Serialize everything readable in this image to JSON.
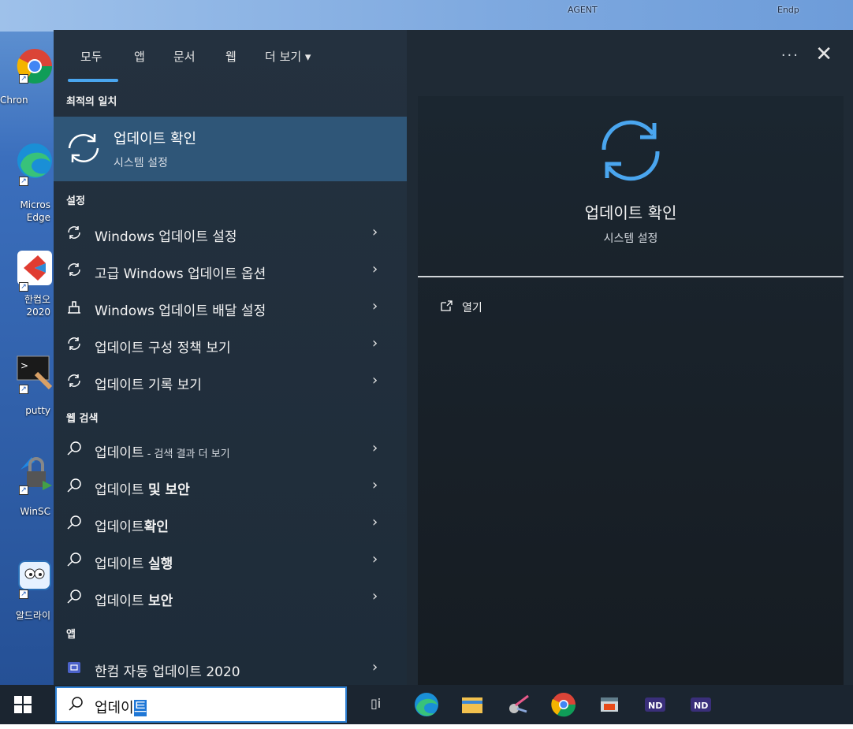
{
  "desktop": {
    "top_labels": [
      "AGENT",
      "Endp"
    ],
    "icons": [
      {
        "label": "Chron"
      },
      {
        "label": "Micros Edge"
      },
      {
        "label": "한컴오 2020"
      },
      {
        "label": "putty"
      },
      {
        "label": "WinSC"
      },
      {
        "label": "알드라이"
      }
    ]
  },
  "search_panel": {
    "tabs": [
      "모두",
      "앱",
      "문서",
      "웹",
      "더 보기 ▾"
    ],
    "more_label": "···",
    "close_label": "✕",
    "best_match": {
      "section": "최적의 일치",
      "title": "업데이트 확인",
      "subtitle": "시스템 설정"
    },
    "settings_section": "설정",
    "settings_items": [
      "Windows 업데이트 설정",
      "고급 Windows 업데이트 옵션",
      "Windows 업데이트 배달 설정",
      "업데이트 구성 정책 보기",
      "업데이트 기록 보기"
    ],
    "web_section": "웹 검색",
    "web_items": [
      {
        "main": "업데이트",
        "suffix": " - 검색 결과 더 보기",
        "bold": ""
      },
      {
        "main": "업데이트 ",
        "suffix": "",
        "bold": "및 보안"
      },
      {
        "main": "업데이트",
        "suffix": "",
        "bold": "확인"
      },
      {
        "main": "업데이트 ",
        "suffix": "",
        "bold": "실행"
      },
      {
        "main": "업데이트 ",
        "suffix": "",
        "bold": "보안"
      }
    ],
    "apps_section": "앱",
    "apps_items": [
      "한컴 자동 업데이트 2020"
    ],
    "preview": {
      "title": "업데이트 확인",
      "subtitle": "시스템 설정",
      "action_open": "열기"
    }
  },
  "taskbar": {
    "search_text_plain": "업데이",
    "search_text_selected": "트",
    "task_view_label": "▯i",
    "app_icons": [
      "edge-icon",
      "file-explorer-icon",
      "snip-icon",
      "chrome-icon",
      "window-app-icon",
      "nd-app-icon",
      "nd-app-icon-2"
    ]
  },
  "colors": {
    "accent": "#4aa6ef",
    "best_match_bg": "#2f5678",
    "panel_bg": "#24313f"
  }
}
